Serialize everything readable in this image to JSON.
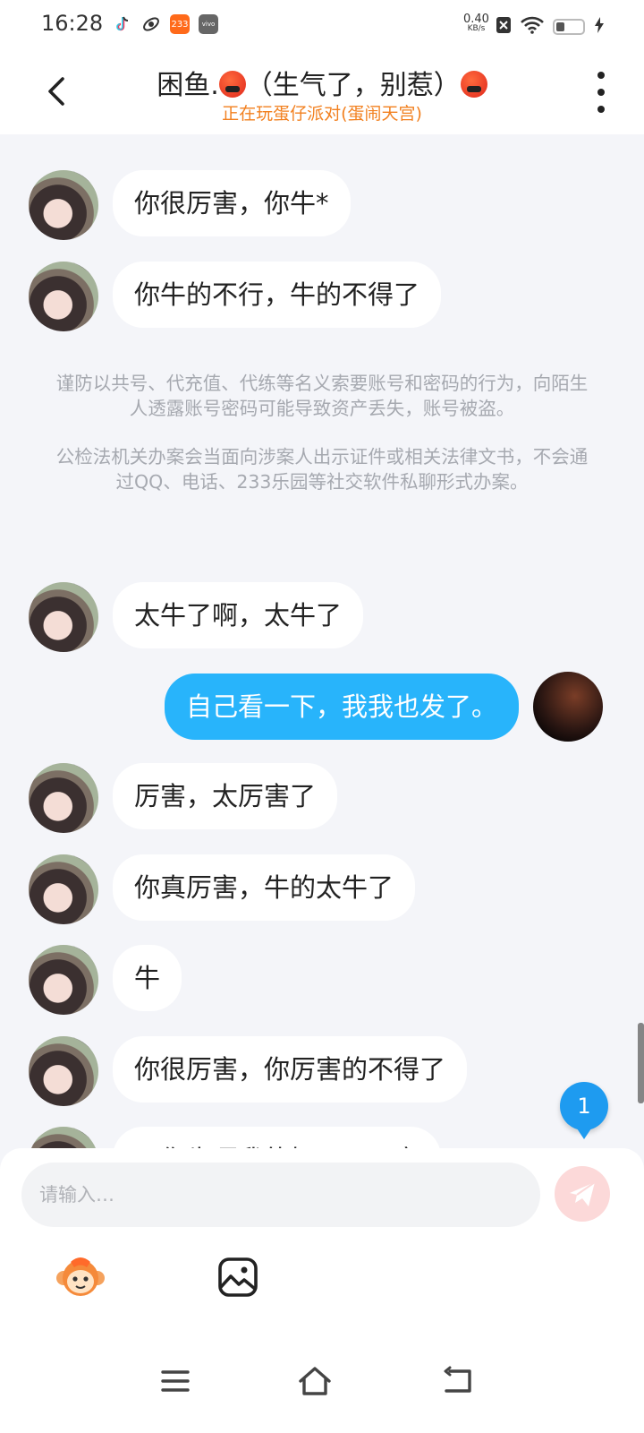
{
  "status_bar": {
    "time": "16:28",
    "app_badge_233": "233",
    "app_badge_vivo": "vivo",
    "net_speed_value": "0.40",
    "net_speed_unit": "KB/s"
  },
  "header": {
    "title": "困鱼.",
    "title_suffix": "（生气了，别惹）",
    "subtitle": "正在玩蛋仔派对(蛋闹天宫)",
    "accent_color": "#f2801f"
  },
  "messages": [
    {
      "text": "你很厉害，你牛*",
      "from": "other"
    },
    {
      "text": "你牛的不行，牛的不得了",
      "from": "other"
    },
    {
      "text": "太牛了啊，太牛了",
      "from": "other"
    },
    {
      "text": "自己看一下，我我也发了。",
      "from": "me"
    },
    {
      "text": "厉害，太厉害了",
      "from": "other"
    },
    {
      "text": "你真厉害，牛的太牛了",
      "from": "other"
    },
    {
      "text": "牛",
      "from": "other"
    },
    {
      "text": "你很厉害，你厉害的不得了",
      "from": "other"
    },
    {
      "text": "只你牛逼我的好吧，厉害",
      "from": "other"
    }
  ],
  "notice": {
    "line1": "谨防以共号、代充值、代练等名义索要账号和密码的行为，向陌生人透露账号密码可能导致资产丢失，账号被盗。",
    "line2": "公检法机关办案会当面向涉案人出示证件或相关法律文书，不会通过QQ、电话、233乐园等社交软件私聊形式办案。"
  },
  "unread_count": "1",
  "composer": {
    "placeholder": "请输入…"
  },
  "colors": {
    "my_bubble": "#28b4fb",
    "background": "#f4f5f9",
    "notice_text": "#a6a9b0"
  }
}
